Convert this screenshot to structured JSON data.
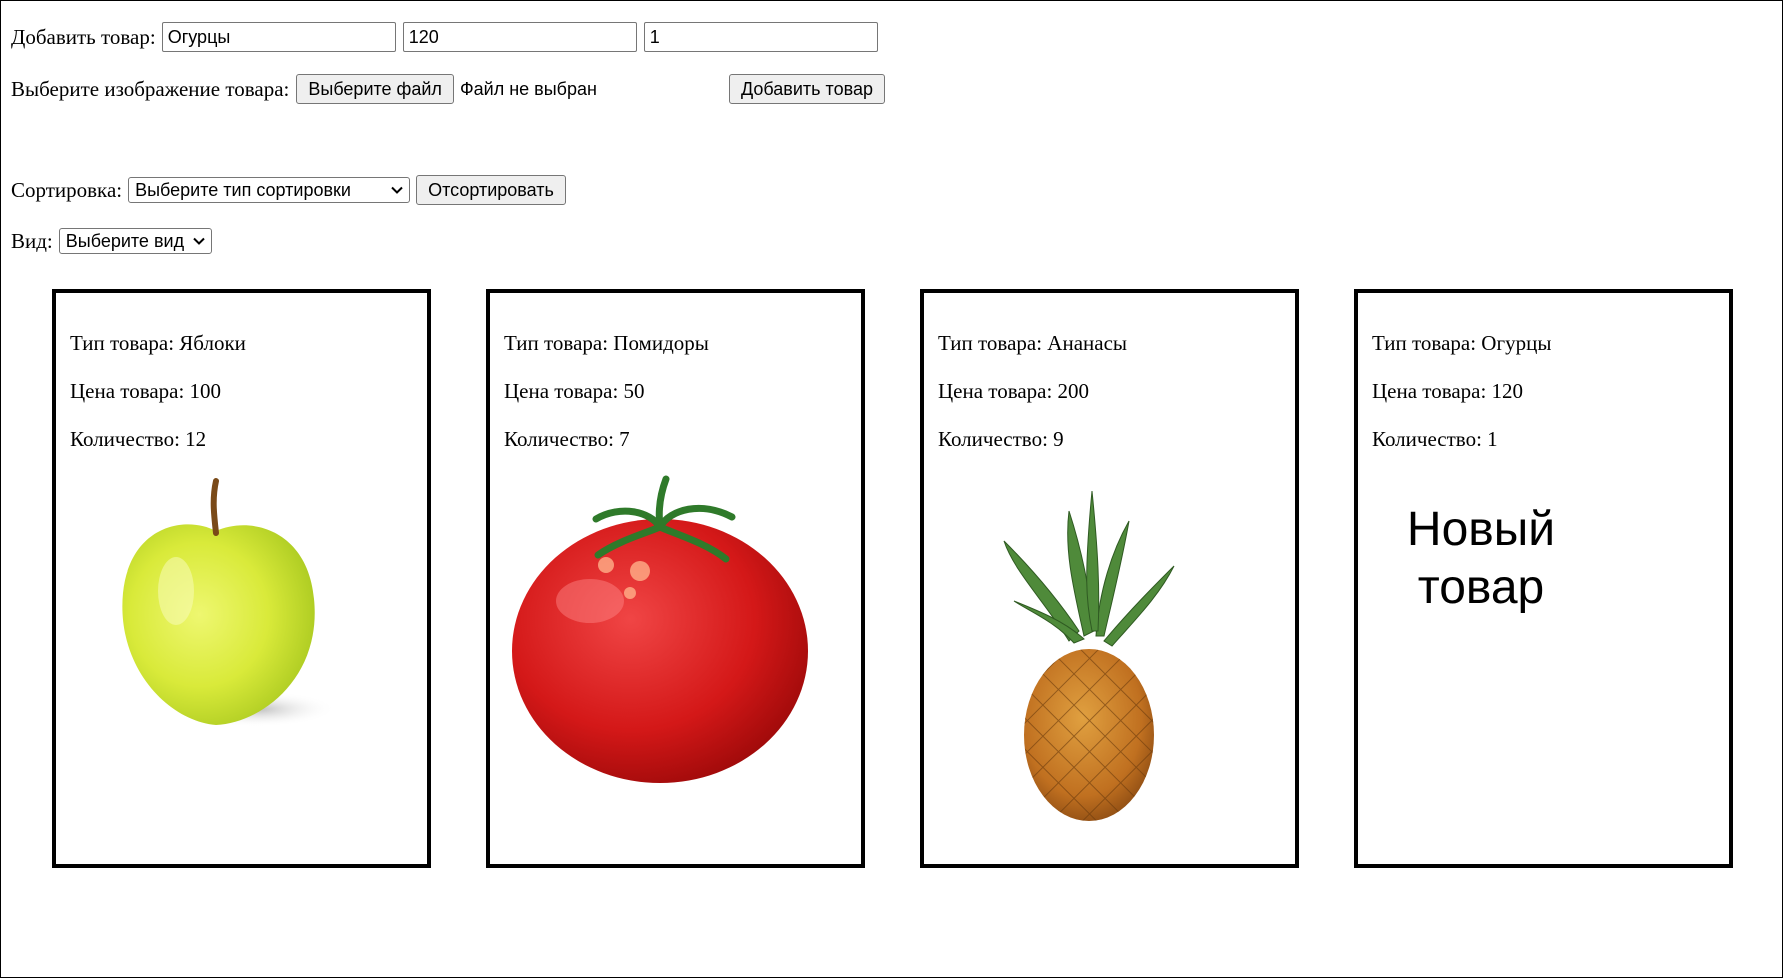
{
  "add_form": {
    "label": "Добавить товар:",
    "name_value": "Огурцы",
    "price_value": "120",
    "quantity_value": "1",
    "image_label": "Выберите изображение товара:",
    "file_button": "Выберите файл",
    "file_status": "Файл не выбран",
    "submit_button": "Добавить товар"
  },
  "sort": {
    "label": "Сортировка:",
    "selected": "Выберите тип сортировки",
    "button": "Отсортировать"
  },
  "view": {
    "label": "Вид:",
    "selected": "Выберите вид"
  },
  "products": [
    {
      "type": "Тип товара: Яблоки",
      "price": "Цена товара: 100",
      "quantity": "Количество: 12",
      "image": "apple-image"
    },
    {
      "type": "Тип товара: Помидоры",
      "price": "Цена товара: 50",
      "quantity": "Количество: 7",
      "image": "tomato-image"
    },
    {
      "type": "Тип товара: Ананасы",
      "price": "Цена товара: 200",
      "quantity": "Количество: 9",
      "image": "pineapple-image"
    },
    {
      "type": "Тип товара: Огурцы",
      "price": "Цена товара: 120",
      "quantity": "Количество: 1",
      "image_text": "Новый товар"
    }
  ]
}
